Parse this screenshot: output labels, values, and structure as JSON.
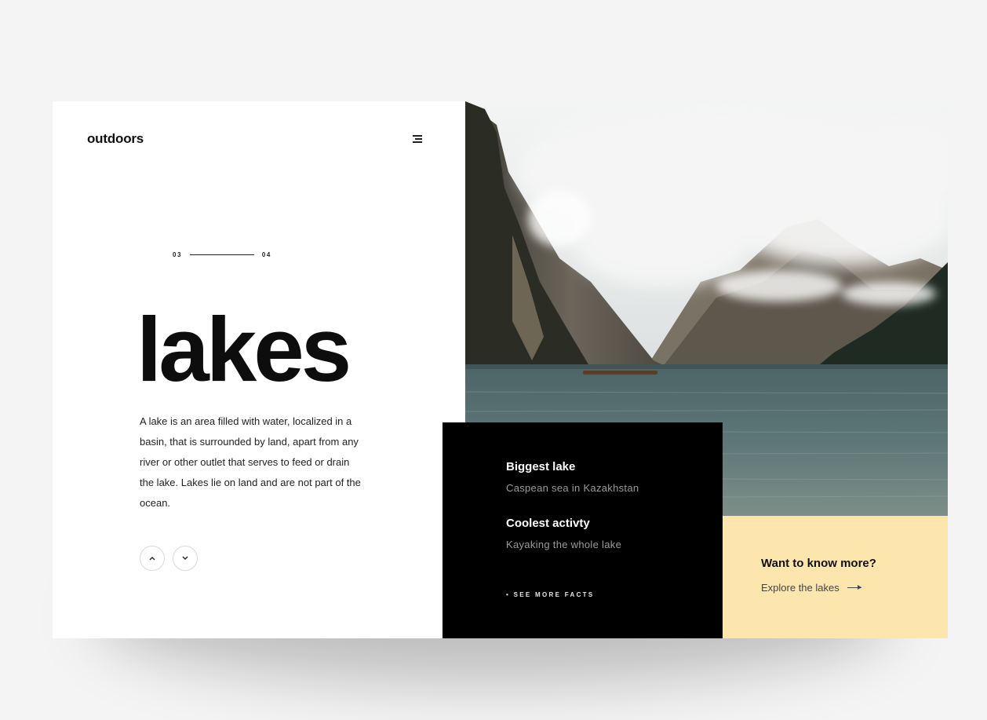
{
  "brand": {
    "logo": "outdoors"
  },
  "pager": {
    "current": "03",
    "total": "04"
  },
  "hero": {
    "title": "lakes",
    "description": "A lake is an area filled with water, localized in a basin, that is surrounded by land, apart from any river or other outlet that serves to feed or drain the lake. Lakes lie on land and are not part of the ocean."
  },
  "icons": {
    "menu": "menu-icon",
    "up": "chevron-up-icon",
    "down": "chevron-down-icon",
    "arrow": "arrow-right-icon"
  },
  "facts": {
    "items": [
      {
        "title": "Biggest lake",
        "subtitle": "Caspean sea in Kazakhstan"
      },
      {
        "title": "Coolest activty",
        "subtitle": "Kayaking the whole lake"
      }
    ],
    "see_more": "• SEE MORE FACTS"
  },
  "cta": {
    "title": "Want to know more?",
    "link": "Explore the lakes"
  },
  "colors": {
    "background": "#f4f4f4",
    "card": "#ffffff",
    "facts_panel": "#000000",
    "cta_panel": "#fde6ad",
    "text_dark": "#0d0d0d"
  }
}
